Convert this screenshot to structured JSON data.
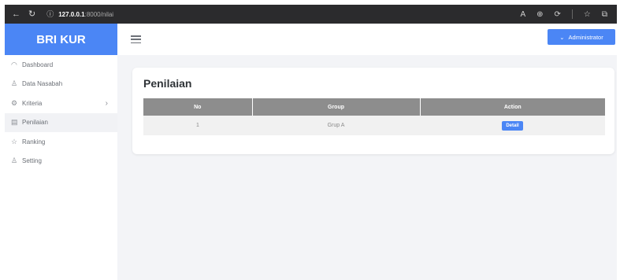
{
  "browser": {
    "url_host": "127.0.0.1",
    "url_path": ":8000/nilai"
  },
  "brand": "BRI KUR",
  "sidebar": {
    "items": [
      {
        "label": "Dashboard",
        "icon": "dashboard-icon",
        "glyph": "◠"
      },
      {
        "label": "Data Nasabah",
        "icon": "users-icon",
        "glyph": "♙"
      },
      {
        "label": "Kriteria",
        "icon": "settings-icon",
        "glyph": "⚙"
      },
      {
        "label": "Penilaian",
        "icon": "form-icon",
        "glyph": "▤"
      },
      {
        "label": "Ranking",
        "icon": "star-icon",
        "glyph": "☆"
      },
      {
        "label": "Setting",
        "icon": "user-icon",
        "glyph": "♙"
      }
    ],
    "active_index": 3
  },
  "topbar": {
    "user_label": "Administrator"
  },
  "main": {
    "title": "Penilaian",
    "table": {
      "headers": [
        "No",
        "Group",
        "Action"
      ],
      "rows": [
        {
          "no": "1",
          "group": "Grup A",
          "action_label": "Detail"
        }
      ]
    }
  },
  "colors": {
    "accent": "#4b86f5",
    "table_header": "#8d8d8d"
  }
}
